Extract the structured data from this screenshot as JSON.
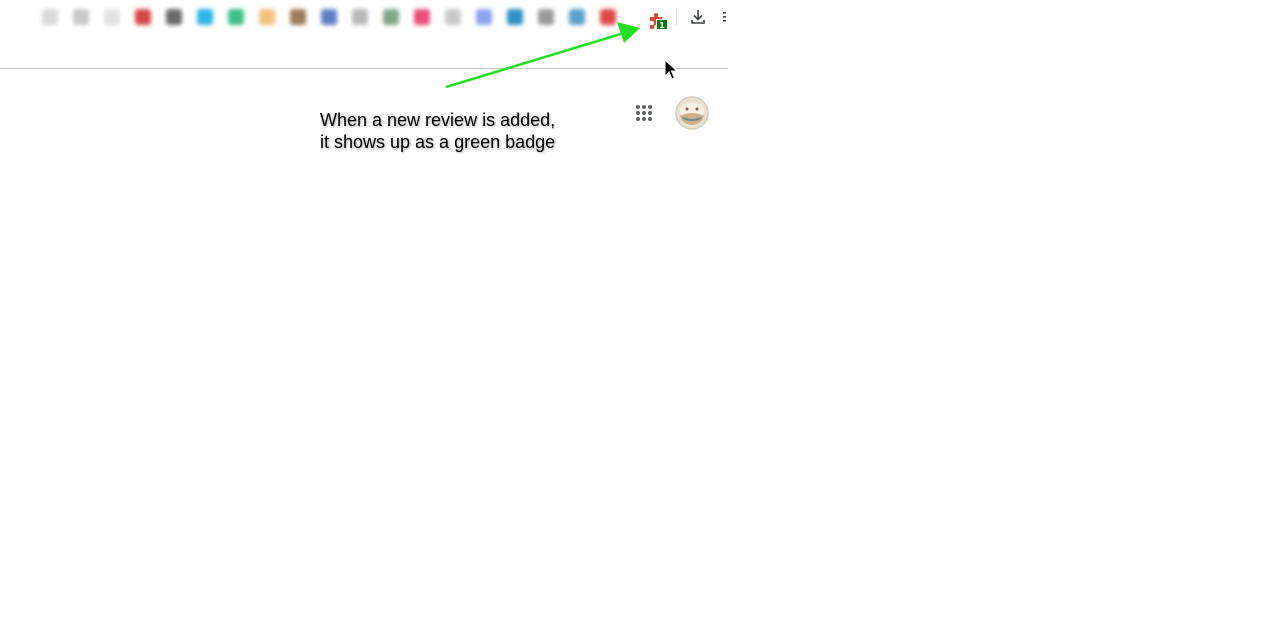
{
  "toolbar": {
    "extension_colors": [
      "#d9d9d9",
      "#c8c8c8",
      "#e2e2e2",
      "#d64a4a",
      "#6a6a6a",
      "#2fb6e8",
      "#3fbf8a",
      "#f0c27a",
      "#a07a5a",
      "#5c7fc4",
      "#b8b8b8",
      "#7fa88a",
      "#e8507a",
      "#c9c9c9",
      "#8fa2f0",
      "#2f8fc4",
      "#9a9a9a",
      "#5aa0c8",
      "#e04848"
    ],
    "puzzle_icon": "puzzle-piece-icon",
    "puzzle_color": "#d94a3a",
    "badge_count": "1",
    "badge_color": "#0a7a12",
    "download_icon": "download-icon",
    "menu_icon": "kebab-menu-icon"
  },
  "page": {
    "apps_icon": "apps-grid-icon",
    "avatar_icon": "profile-avatar-icon"
  },
  "annotation": {
    "line1": "When a new review is added,",
    "line2": "it shows up as a green badge",
    "arrow_color": "#22e022"
  }
}
